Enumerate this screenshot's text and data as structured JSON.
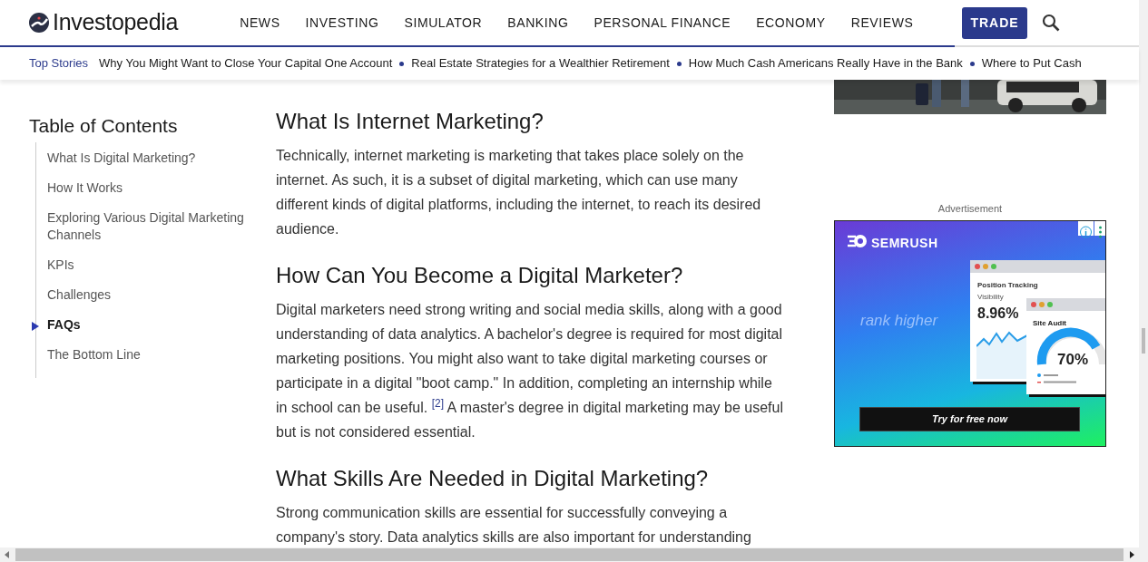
{
  "header": {
    "logo": "Investopedia",
    "nav": [
      "NEWS",
      "INVESTING",
      "SIMULATOR",
      "BANKING",
      "PERSONAL FINANCE",
      "ECONOMY",
      "REVIEWS"
    ],
    "trade_button": "TRADE"
  },
  "reading_progress": {
    "level": 0.838
  },
  "top_stories": {
    "label": "Top Stories",
    "items": [
      "Why You Might Want to Close Your Capital One Account",
      "Real Estate Strategies for a Wealthier Retirement",
      "How Much Cash Americans Really Have in the Bank",
      "Where to Put Cash"
    ]
  },
  "toc": {
    "title": "Table of Contents",
    "items": [
      {
        "label": "What Is Digital Marketing?",
        "selected": false
      },
      {
        "label": "How It Works",
        "selected": false
      },
      {
        "label": "Exploring Various Digital Marketing Channels",
        "selected": false
      },
      {
        "label": "KPIs",
        "selected": false
      },
      {
        "label": "Challenges",
        "selected": false
      },
      {
        "label": "FAQs",
        "selected": true
      },
      {
        "label": "The Bottom Line",
        "selected": false
      }
    ]
  },
  "article": {
    "sections": [
      {
        "heading": "What Is Internet Marketing?",
        "paragraph": "Technically, internet marketing is marketing that takes place solely on the internet. As such, it is a subset of digital marketing, which can use many different kinds of digital platforms, including the internet, to reach its desired audience."
      },
      {
        "heading": "How Can You Become a Digital Marketer?",
        "paragraph": "Digital marketers need strong writing and social media skills, along with a good understanding of data analytics. A bachelor's degree is required for most digital marketing positions. You might also want to take digital marketing courses or participate in a digital \"boot camp.\" In addition, completing an internship while in school can be useful. $^{[2]}$ A master's degree in digital marketing may be useful but is not considered essential."
      },
      {
        "heading": "What Skills Are Needed in Digital Marketing?",
        "paragraph": "Strong communication skills are essential for successfully conveying a company's story. Data analytics skills are also important for understanding"
      }
    ]
  },
  "sidebar": {
    "ad_label": "Advertisement",
    "ad": {
      "brand": "SEMRUSH",
      "tagline": "rank higher",
      "card_title": "Position Tracking",
      "metric_label": "Visibility",
      "metric_value": "8.96%",
      "audit_title": "Site Audit",
      "gauge_value": "70%",
      "cta": "Try for free now"
    }
  }
}
